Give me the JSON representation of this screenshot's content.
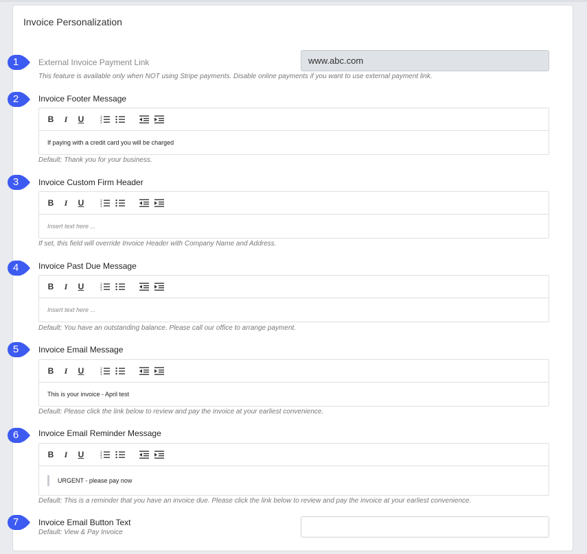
{
  "panel": {
    "title": "Invoice Personalization"
  },
  "toolbar": {
    "bold": "B",
    "italic": "I",
    "underline": "U"
  },
  "fields": {
    "payment_link": {
      "badge": "1",
      "label": "External Invoice Payment Link",
      "value": "www.abc.com",
      "hint": "This feature is available only when NOT using Stripe payments. Disable online payments if you want to use external payment link."
    },
    "footer": {
      "badge": "2",
      "label": "Invoice Footer Message",
      "content": "If paying with a credit card you will be charged",
      "hint": "Default: Thank you for your business."
    },
    "firm_header": {
      "badge": "3",
      "label": "Invoice Custom Firm Header",
      "placeholder": "Insert text here ...",
      "hint": "If set, this field will override Invoice Header with Company Name and Address."
    },
    "past_due": {
      "badge": "4",
      "label": "Invoice Past Due Message",
      "placeholder": "Insert text here ...",
      "hint": "Default: You have an outstanding balance. Please call our office to arrange payment."
    },
    "email_message": {
      "badge": "5",
      "label": "Invoice Email Message",
      "content": "This is your invoice - April test",
      "hint": "Default: Please click the link below to review and pay the invoice at your earliest convenience."
    },
    "email_reminder": {
      "badge": "6",
      "label": "Invoice Email Reminder Message",
      "content": "URGENT - please pay now",
      "hint": "Default: This is a reminder that you have an invoice due. Please click the link below to review and pay the invoice at your earliest convenience."
    },
    "button_text": {
      "badge": "7",
      "label": "Invoice Email Button Text",
      "hint": "Default: View & Pay Invoice",
      "value": ""
    }
  },
  "colors": {
    "badge": "#3d5af1",
    "disabled_input": "#dfe2e6"
  }
}
